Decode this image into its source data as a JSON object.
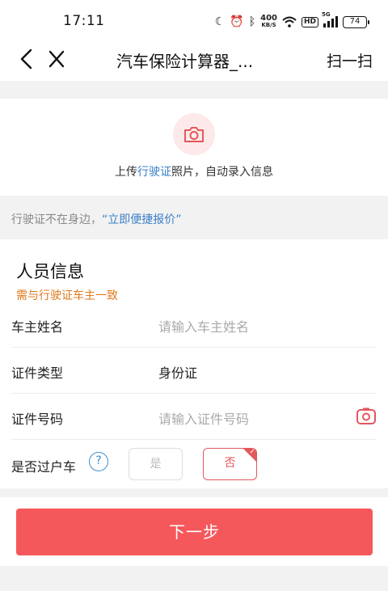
{
  "status_bar": {
    "time": "17:11",
    "net_speed": "400",
    "net_unit": "KB/S",
    "hd": "HD",
    "signal": "5G",
    "battery": "74"
  },
  "nav": {
    "title": "汽车保险计算器_...",
    "scan_label": "扫一扫"
  },
  "upload": {
    "prefix": "上传",
    "link": "行驶证",
    "suffix": "照片，自动录入信息"
  },
  "quick_quote": {
    "text": "行驶证不在身边，",
    "link": "“立即便捷报价”"
  },
  "person_info": {
    "title": "人员信息",
    "subtitle": "需与行驶证车主一致",
    "owner_name": {
      "label": "车主姓名",
      "placeholder": "请输入车主姓名"
    },
    "id_type": {
      "label": "证件类型",
      "value": "身份证"
    },
    "id_number": {
      "label": "证件号码",
      "placeholder": "请输入证件号码"
    },
    "transfer": {
      "label": "是否过户车",
      "help": "?",
      "yes": "是",
      "no": "否",
      "selected": "否"
    }
  },
  "actions": {
    "next_label": "下一步"
  },
  "colors": {
    "accent": "#f5585b",
    "link": "#3b7fc9",
    "warning": "#e07a1f"
  }
}
